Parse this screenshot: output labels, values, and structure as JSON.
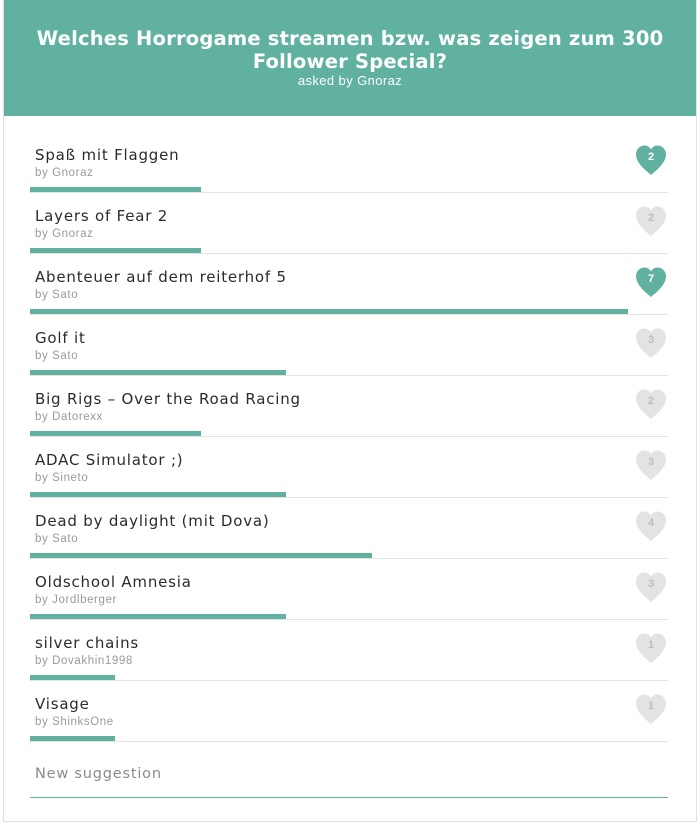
{
  "header": {
    "title": "Welches Horrogame streamen bzw. was zeigen zum 300 Follower Special?",
    "asked_by": "asked by Gnoraz"
  },
  "colors": {
    "accent": "#60b19f",
    "heart_off": "#e3e3e3"
  },
  "items": [
    {
      "name": "Spaß mit Flaggen",
      "by": "by Gnoraz",
      "votes": "2",
      "share": 0.2857,
      "voted": true
    },
    {
      "name": "Layers of Fear 2",
      "by": "by Gnoraz",
      "votes": "2",
      "share": 0.2857,
      "voted": false
    },
    {
      "name": "Abenteuer auf dem reiterhof 5",
      "by": "by Sato",
      "votes": "7",
      "share": 1.0,
      "voted": true
    },
    {
      "name": "Golf it",
      "by": "by Sato",
      "votes": "3",
      "share": 0.4286,
      "voted": false
    },
    {
      "name": "Big Rigs – Over the Road Racing",
      "by": "by Datorexx",
      "votes": "2",
      "share": 0.2857,
      "voted": false
    },
    {
      "name": "ADAC Simulator ;)",
      "by": "by Sineto",
      "votes": "3",
      "share": 0.4286,
      "voted": false
    },
    {
      "name": "Dead by daylight (mit Dova)",
      "by": "by Sato",
      "votes": "4",
      "share": 0.5714,
      "voted": false
    },
    {
      "name": "Oldschool Amnesia",
      "by": "by Jordlberger",
      "votes": "3",
      "share": 0.4286,
      "voted": false
    },
    {
      "name": "silver chains",
      "by": "by Dovakhin1998",
      "votes": "1",
      "share": 0.1429,
      "voted": false
    },
    {
      "name": "Visage",
      "by": "by ShinksOne",
      "votes": "1",
      "share": 0.1429,
      "voted": false
    }
  ],
  "suggestion": {
    "placeholder": "New suggestion"
  },
  "icons": {
    "vote": "heart-icon"
  }
}
